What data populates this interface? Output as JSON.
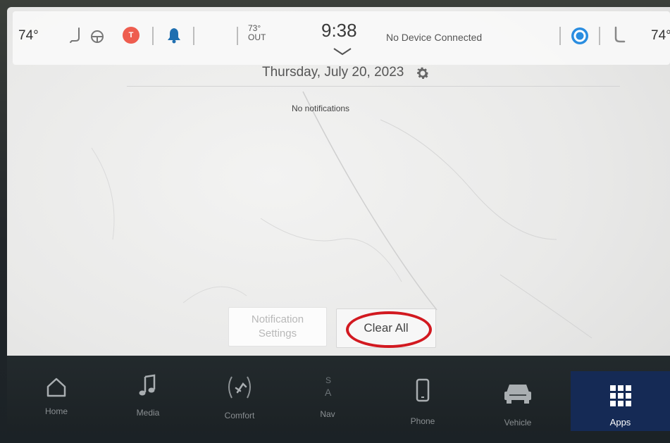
{
  "status_bar": {
    "temp_left": "74°",
    "profile_initial": "T",
    "outside_temp": "73°",
    "outside_label": "OUT",
    "clock": "9:38",
    "device_status": "No Device Connected",
    "temp_right": "74°"
  },
  "notifications": {
    "date": "Thursday, July 20, 2023",
    "empty_message": "No notifications",
    "settings_button_line1": "Notification",
    "settings_button_line2": "Settings",
    "clear_all_button": "Clear All"
  },
  "nav": {
    "items": [
      {
        "label": "Home",
        "icon": "home-icon"
      },
      {
        "label": "Media",
        "icon": "music-note-icon"
      },
      {
        "label": "Comfort",
        "icon": "seat-heat-icon"
      },
      {
        "label": "Nav",
        "icon": "compass-icon",
        "compass_s": "S",
        "compass_a": "A"
      },
      {
        "label": "Phone",
        "icon": "phone-icon"
      },
      {
        "label": "Vehicle",
        "icon": "car-icon"
      },
      {
        "label": "Apps",
        "icon": "grid-icon"
      }
    ]
  },
  "colors": {
    "highlight_ring": "#d21920",
    "apps_active": "#152a55",
    "profile_badge": "#ee5d4f",
    "assistant_blue": "#2a8de0"
  }
}
